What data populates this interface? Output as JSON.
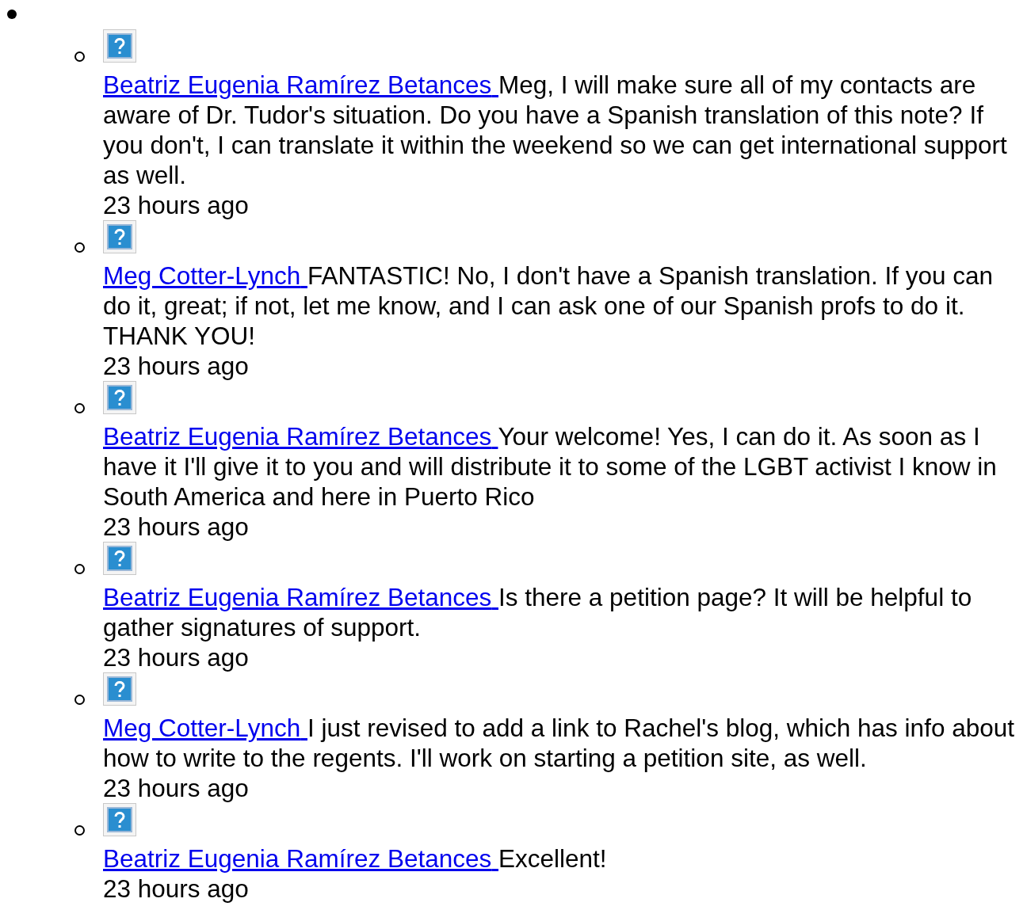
{
  "comments": [
    {
      "author": "Beatriz Eugenia Ramírez Betances",
      "text": "Meg, I will make sure all of my contacts are aware of Dr. Tudor's situation. Do you have a Spanish translation of this note? If you don't, I can translate it within the weekend so we can get international support as well.",
      "time": "23 hours ago"
    },
    {
      "author": "Meg Cotter-Lynch",
      "text": "FANTASTIC! No, I don't have a Spanish translation. If you can do it, great; if not, let me know, and I can ask one of our Spanish profs to do it. THANK YOU!",
      "time": "23 hours ago"
    },
    {
      "author": "Beatriz Eugenia Ramírez Betances",
      "text": "Your welcome! Yes, I can do it. As soon as I have it I'll give it to you and will distribute it to some of the LGBT activist I know in South America and here in Puerto Rico",
      "time": "23 hours ago"
    },
    {
      "author": "Beatriz Eugenia Ramírez Betances",
      "text": "Is there a petition page? It will be helpful to gather signatures of support.",
      "time": "23 hours ago"
    },
    {
      "author": "Meg Cotter-Lynch",
      "text": "I just revised to add a link to Rachel's blog, which has info about how to write to the regents. I'll work on starting a petition site, as well.",
      "time": "23 hours ago"
    },
    {
      "author": "Beatriz Eugenia Ramírez Betances",
      "text": "Excellent!",
      "time": "23 hours ago"
    }
  ]
}
